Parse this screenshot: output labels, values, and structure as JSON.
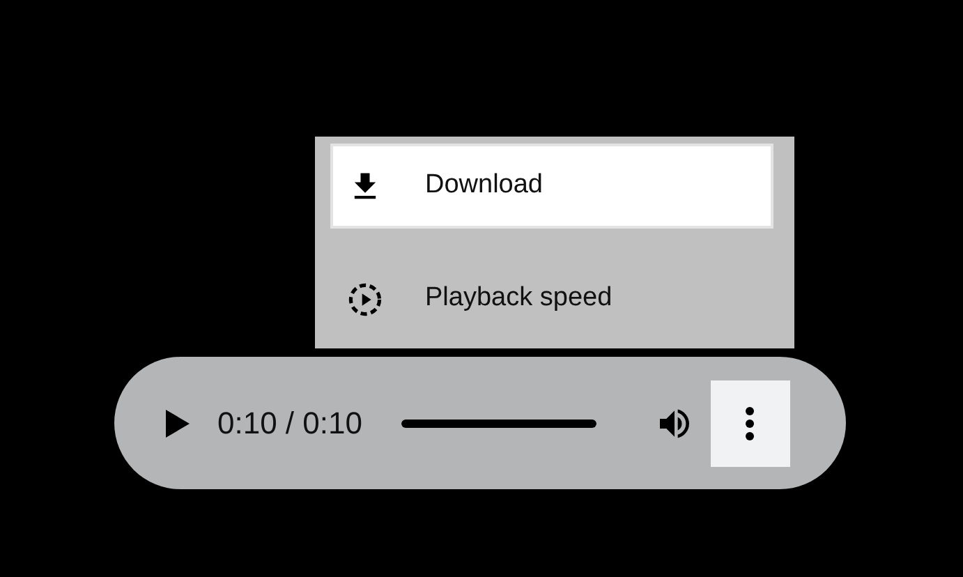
{
  "menu": {
    "items": [
      {
        "kind": "download",
        "label": "Download",
        "selected": true
      },
      {
        "kind": "speed",
        "label": "Playback speed",
        "selected": false
      }
    ]
  },
  "player": {
    "playing": false,
    "time": "0:10 / 0:10",
    "progress": {
      "level": 1
    },
    "more_button": {
      "expanded": true
    }
  }
}
